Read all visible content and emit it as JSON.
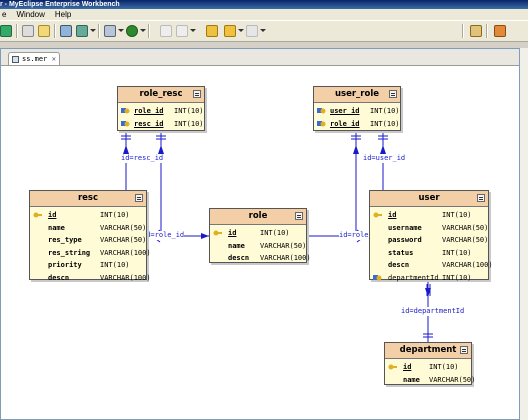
{
  "window": {
    "title": "r - MyEclipse Enterprise Workbench"
  },
  "menu": [
    "e",
    "Window",
    "Help"
  ],
  "editor": {
    "tab_label": "ss.mer"
  },
  "entities": {
    "role_resc": {
      "name": "role_resc",
      "columns": [
        {
          "name": "role_id",
          "type": "INT(10)"
        },
        {
          "name": "resc_id",
          "type": "INT(10)"
        }
      ]
    },
    "user_role": {
      "name": "user_role",
      "columns": [
        {
          "name": "user_id",
          "type": "INT(10)"
        },
        {
          "name": "role_id",
          "type": "INT(10)"
        }
      ]
    },
    "resc": {
      "name": "resc",
      "columns": [
        {
          "name": "id",
          "type": "INT(10)"
        },
        {
          "name": "name",
          "type": "VARCHAR(50)"
        },
        {
          "name": "res_type",
          "type": "VARCHAR(50)"
        },
        {
          "name": "res_string",
          "type": "VARCHAR(100)"
        },
        {
          "name": "priority",
          "type": "INT(10)"
        },
        {
          "name": "descn",
          "type": "VARCHAR(100)"
        }
      ]
    },
    "role": {
      "name": "role",
      "columns": [
        {
          "name": "id",
          "type": "INT(10)"
        },
        {
          "name": "name",
          "type": "VARCHAR(50)"
        },
        {
          "name": "descn",
          "type": "VARCHAR(100)"
        }
      ]
    },
    "user": {
      "name": "user",
      "columns": [
        {
          "name": "id",
          "type": "INT(10)"
        },
        {
          "name": "username",
          "type": "VARCHAR(50)"
        },
        {
          "name": "password",
          "type": "VARCHAR(50)"
        },
        {
          "name": "status",
          "type": "INT(10)"
        },
        {
          "name": "descn",
          "type": "VARCHAR(100)"
        },
        {
          "name": "departmentId",
          "type": "INT(10)"
        }
      ]
    },
    "department": {
      "name": "department",
      "columns": [
        {
          "name": "id",
          "type": "INT(10)"
        },
        {
          "name": "name",
          "type": "VARCHAR(50)"
        }
      ]
    }
  },
  "relationships": {
    "resc_to_role_resc": "id=resc_id",
    "resc_to_role": "id=role_id",
    "role_to_user": "id=role_id",
    "user_role_to_user": "id=user_id",
    "user_to_department": "id=departmentId"
  },
  "colors": {
    "entity_header": "#f2cfa6",
    "entity_body": "#fffbd6",
    "relationship_line": "#1a1ac8"
  }
}
